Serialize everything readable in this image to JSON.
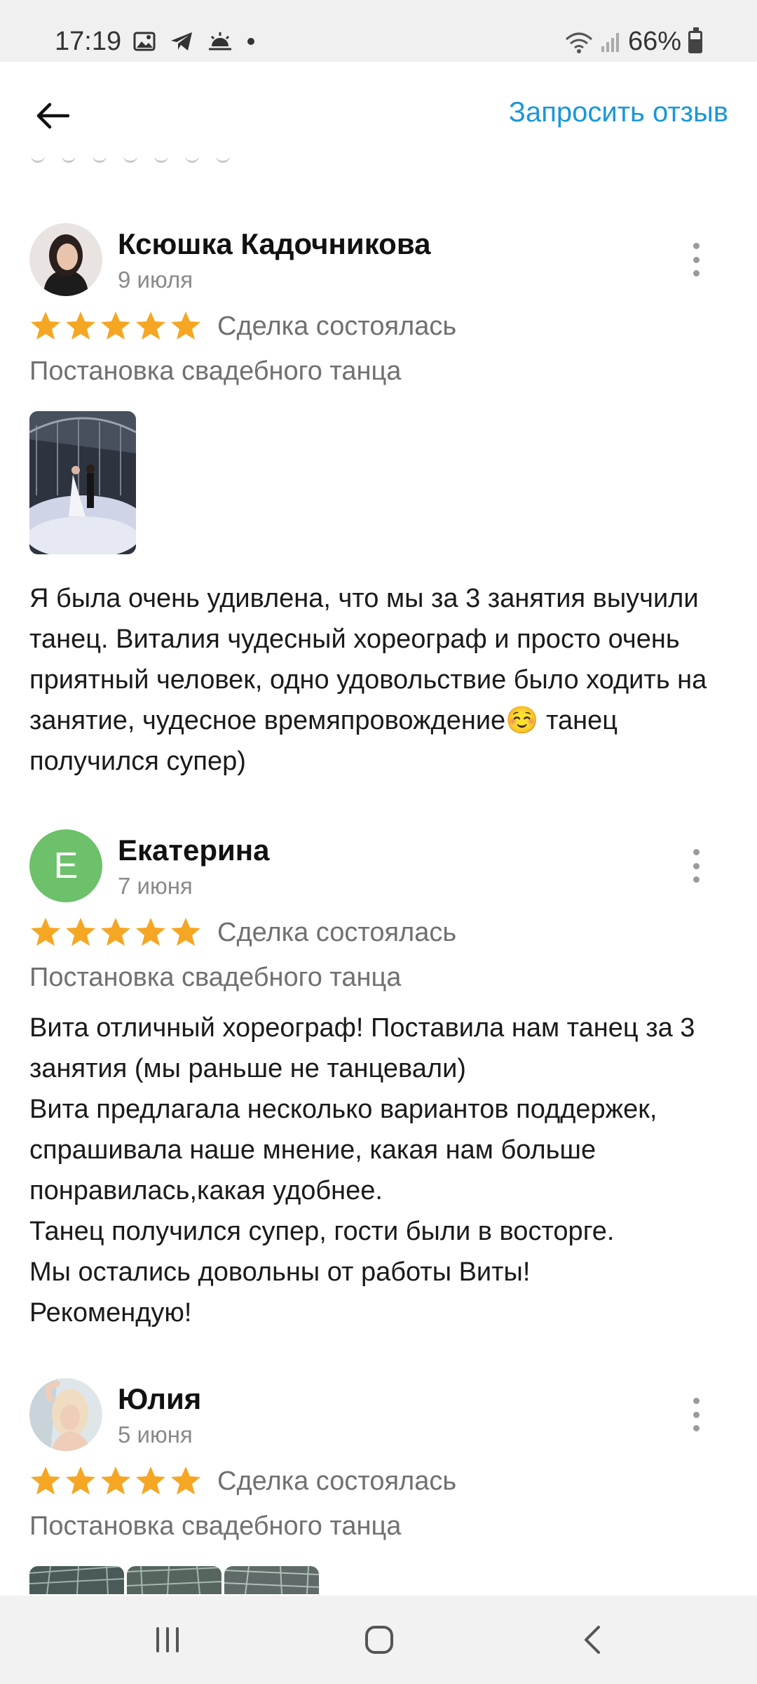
{
  "status_bar": {
    "time": "17:19",
    "battery": "66%",
    "icons": [
      "gallery-icon",
      "telegram-icon",
      "weather-icon",
      "dot-icon",
      "wifi-icon",
      "signal-icon",
      "battery-icon"
    ]
  },
  "header": {
    "request_review_label": "Запросить отзыв"
  },
  "colors": {
    "accent": "#1a97d8",
    "star": "#f5a623",
    "avatar_letter_bg": "#6cc16a"
  },
  "reviews": [
    {
      "author": "Ксюшка Кадочникова",
      "date": "9 июля",
      "rating": 5,
      "status": "Сделка состоялась",
      "service": "Постановка свадебного танца",
      "text": "Я была очень удивлена, что мы за 3 занятия выучили танец. Виталия чудесный хореограф и просто очень приятный человек, одно удовольствие было ходить на занятие, чудесное времяпровождение☺️ танец получился супер)"
    },
    {
      "author": "Екатерина",
      "avatar_letter": "Е",
      "date": "7 июня",
      "rating": 5,
      "status": "Сделка состоялась",
      "service": "Постановка свадебного танца",
      "text": "Вита отличный хореограф! Поставила нам танец за 3 занятия (мы раньше не танцевали)\nВита предлагала несколько вариантов поддержек, спрашивала наше мнение, какая нам больше понравилась,какая удобнее.\nТанец получился супер, гости были в восторге.\nМы остались довольны от работы Виты!\nРекомендую!"
    },
    {
      "author": "Юлия",
      "date": "5 июня",
      "rating": 5,
      "status": "Сделка состоялась",
      "service": "Постановка свадебного танца"
    }
  ]
}
